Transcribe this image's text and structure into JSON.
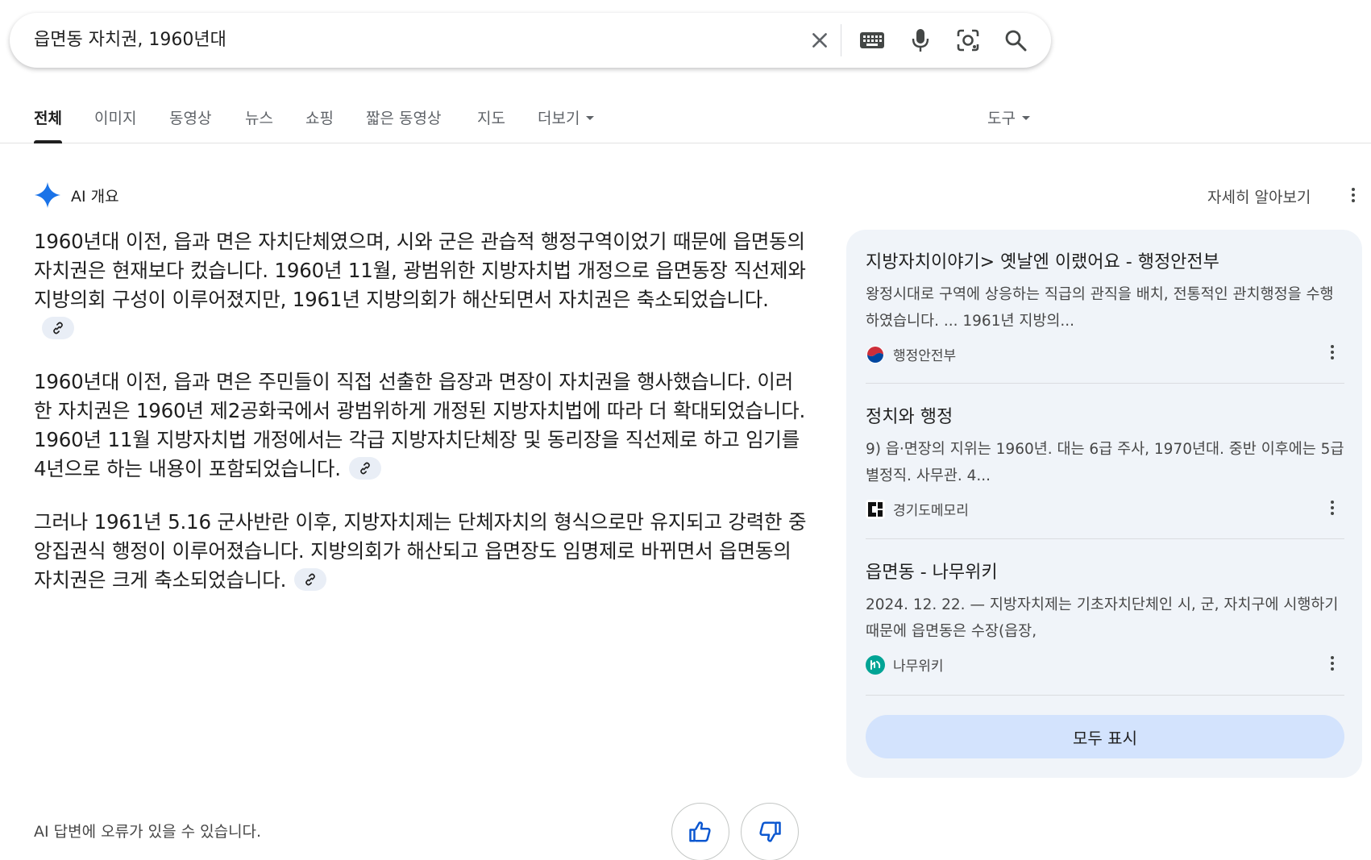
{
  "search": {
    "query": "읍면동 자치권, 1960년대",
    "icons": [
      "clear-icon",
      "keyboard-icon",
      "mic-icon",
      "lens-icon",
      "search-icon"
    ]
  },
  "tabs": [
    {
      "label": "전체",
      "active": true
    },
    {
      "label": "이미지"
    },
    {
      "label": "동영상"
    },
    {
      "label": "뉴스"
    },
    {
      "label": "쇼핑"
    },
    {
      "label": "짧은 동영상"
    },
    {
      "label": "지도"
    },
    {
      "label": "더보기"
    }
  ],
  "tools_label": "도구",
  "ai_overview": {
    "title": "AI 개요",
    "learn_more": "자세히 알아보기",
    "paragraphs": [
      "1960년대 이전, 읍과 면은 자치단체였으며, 시와 군은 관습적 행정구역이었기 때문에 읍면동의 자치권은 현재보다 컸습니다. 1960년 11월, 광범위한 지방자치법 개정으로 읍면동장 직선제와 지방의회 구성이 이루어졌지만, 1961년 지방의회가 해산되면서 자치권은 축소되었습니다.",
      "1960년대 이전, 읍과 면은 주민들이 직접 선출한 읍장과 면장이 자치권을 행사했습니다. 이러한 자치권은 1960년 제2공화국에서 광범위하게 개정된 지방자치법에 따라 더 확대되었습니다. 1960년 11월 지방자치법 개정에서는 각급 지방자치단체장 및 동리장을 직선제로 하고 임기를 4년으로 하는 내용이 포함되었습니다.",
      "그러나 1961년 5.16 군사반란 이후, 지방자치제는 단체자치의 형식으로만 유지되고 강력한 중앙집권식 행정이 이루어졌습니다. 지방의회가 해산되고 읍면장도 임명제로 바뀌면서 읍면동의 자치권은 크게 축소되었습니다."
    ],
    "disclaimer": "AI 답변에 오류가 있을 수 있습니다."
  },
  "sources": [
    {
      "title": "지방자치이야기> 옛날엔 이랬어요 - 행정안전부",
      "snippet": "왕정시대로 구역에 상응하는 직급의 관직을 배치, 전통적인 관치행정을 수행하였습니다. ... 1961년 지방의...",
      "site": "행정안전부"
    },
    {
      "title": "정치와 행정",
      "snippet": "9) 읍·면장의 지위는 1960년. 대는 6급 주사, 1970년대. 중반 이후에는 5급 별정직. 사무관. 4...",
      "site": "경기도메모리"
    },
    {
      "title": "읍면동 - 나무위키",
      "snippet": "2024. 12. 22. — 지방자치제는 기초자치단체인 시, 군, 자치구에 시행하기 때문에 읍면동은 수장(읍장,",
      "site": "나무위키"
    }
  ],
  "show_all": "모두 표시",
  "colors": {
    "accent_blue": "#1a73e8",
    "chip_bg": "#e9eef6",
    "panel_bg": "#f0f4f9",
    "button_bg": "#d3e3fd"
  }
}
